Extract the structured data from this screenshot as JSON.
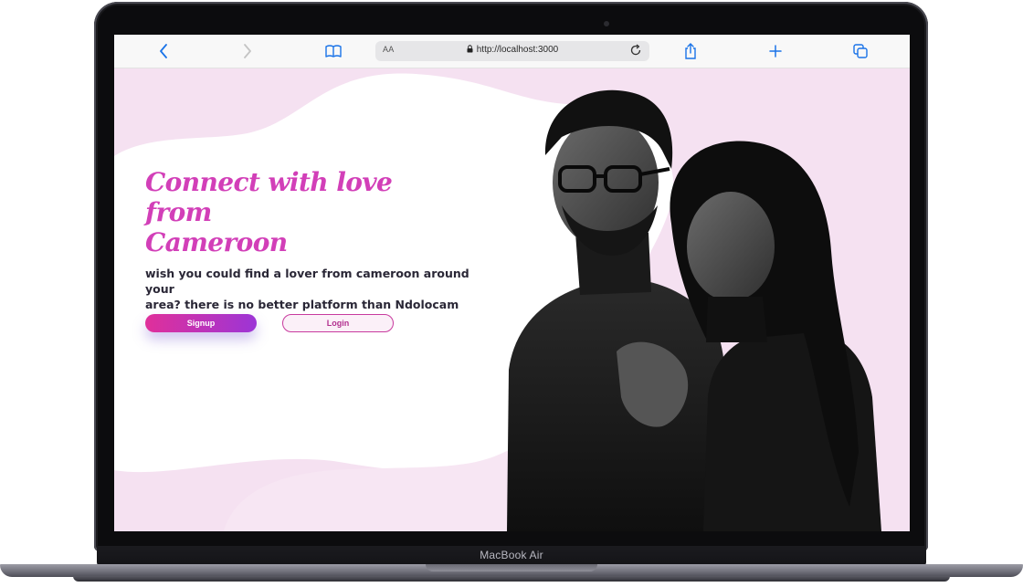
{
  "device": {
    "model_label": "MacBook Air"
  },
  "browser": {
    "address": {
      "text_size_label": "AA",
      "url": "http://localhost:3000"
    },
    "icons": [
      "back-icon",
      "forward-icon",
      "reader-icon",
      "lock-icon",
      "reload-icon",
      "share-icon",
      "new-tab-icon",
      "tabs-icon"
    ]
  },
  "hero": {
    "title_line1": "Connect with love from",
    "title_line2": "Cameroon",
    "subtitle_line1": "wish you could find a lover from cameroon around your",
    "subtitle_line2": "area? there is no better platform than Ndolocam",
    "signup_label": "Signup",
    "login_label": "Login"
  },
  "colors": {
    "accent": "#d23fb8",
    "page_background": "#f5e1f1",
    "signup_gradient_start": "#e0309a",
    "signup_gradient_end": "#9c35d6"
  }
}
